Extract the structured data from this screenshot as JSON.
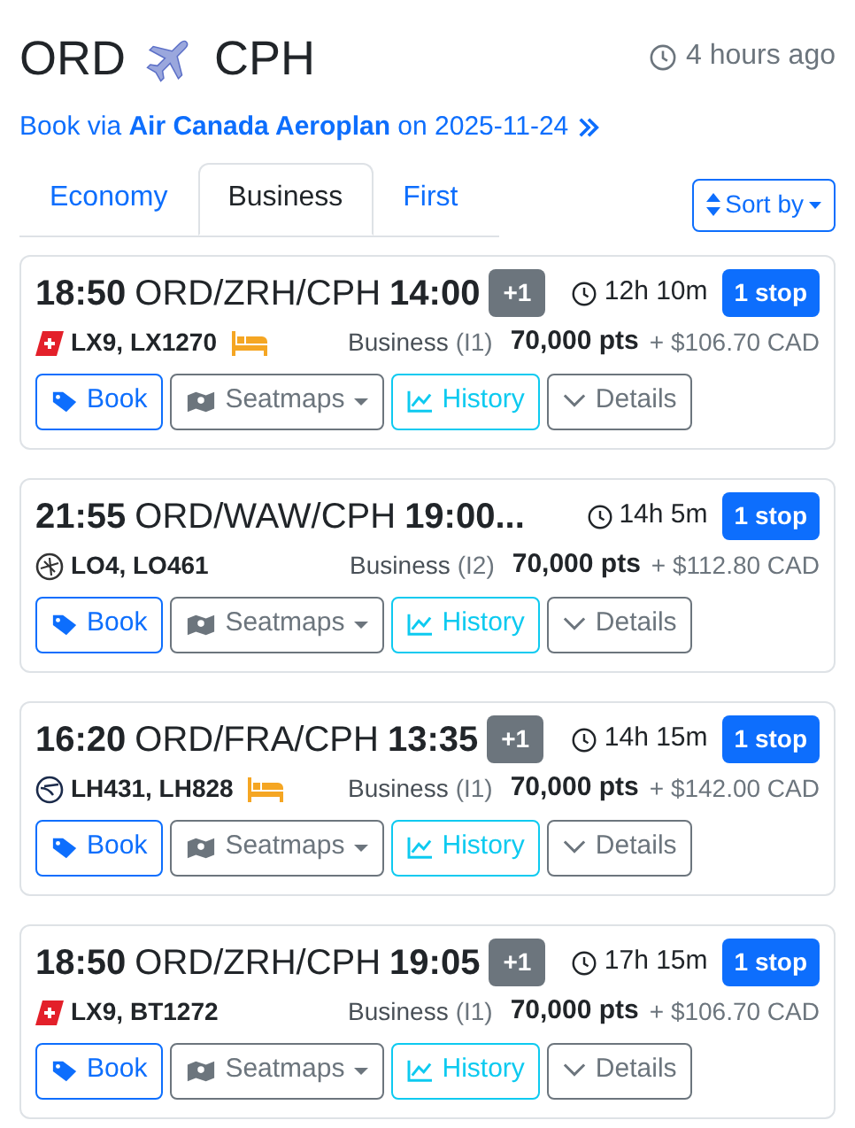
{
  "header": {
    "origin": "ORD",
    "destination": "CPH",
    "updated": "4 hours ago"
  },
  "booking_link": {
    "text": "Book via **Air Canada Aeroplan** on 2025-11-24"
  },
  "tabs": [
    {
      "label": "Economy",
      "selected": false
    },
    {
      "label": "Business",
      "selected": true
    },
    {
      "label": "First",
      "selected": false
    }
  ],
  "sort_button": {
    "label": "Sort by"
  },
  "flights": [
    {
      "departure": "18:50",
      "route": "ORD/ZRH/CPH",
      "arrival": "14:00",
      "day_offset": "+1",
      "duration": "12h 10m",
      "stops": "1 stop",
      "kind": "swiss",
      "flight_numbers": "LX9, LX1270",
      "lie_flat": true,
      "cabin": "Business",
      "fare_class": "(I1)",
      "points": "70,000 pts",
      "cash": "+ $106.70 CAD",
      "actions": [
        {
          "kind": "book",
          "label": "Book"
        },
        {
          "kind": "seatmaps",
          "label": "Seatmaps"
        },
        {
          "kind": "history",
          "label": "History"
        },
        {
          "kind": "details",
          "label": "Details"
        }
      ]
    },
    {
      "departure": "21:55",
      "route": "ORD/WAW/CPH",
      "arrival": "19:00...",
      "duration": "14h 5m",
      "stops": "1 stop",
      "kind": "lot",
      "flight_numbers": "LO4, LO461",
      "lie_flat": false,
      "cabin": "Business",
      "fare_class": "(I2)",
      "points": "70,000 pts",
      "cash": "+ $112.80 CAD",
      "actions": [
        {
          "kind": "book",
          "label": "Book"
        },
        {
          "kind": "seatmaps",
          "label": "Seatmaps"
        },
        {
          "kind": "history",
          "label": "History"
        },
        {
          "kind": "details",
          "label": "Details"
        }
      ]
    },
    {
      "departure": "16:20",
      "route": "ORD/FRA/CPH",
      "arrival": "13:35",
      "day_offset": "+1",
      "duration": "14h 15m",
      "stops": "1 stop",
      "kind": "lufthansa",
      "flight_numbers": "LH431, LH828",
      "lie_flat": true,
      "cabin": "Business",
      "fare_class": "(I1)",
      "points": "70,000 pts",
      "cash": "+ $142.00 CAD",
      "actions": [
        {
          "kind": "book",
          "label": "Book"
        },
        {
          "kind": "seatmaps",
          "label": "Seatmaps"
        },
        {
          "kind": "history",
          "label": "History"
        },
        {
          "kind": "details",
          "label": "Details"
        }
      ]
    },
    {
      "departure": "18:50",
      "route": "ORD/ZRH/CPH",
      "arrival": "19:05",
      "day_offset": "+1",
      "duration": "17h 15m",
      "stops": "1 stop",
      "kind": "swiss",
      "flight_numbers": "LX9, BT1272",
      "lie_flat": false,
      "cabin": "Business",
      "fare_class": "(I1)",
      "points": "70,000 pts",
      "cash": "+ $106.70 CAD",
      "actions": [
        {
          "kind": "book",
          "label": "Book"
        },
        {
          "kind": "seatmaps",
          "label": "Seatmaps"
        },
        {
          "kind": "history",
          "label": "History"
        },
        {
          "kind": "details",
          "label": "Details"
        }
      ]
    }
  ]
}
